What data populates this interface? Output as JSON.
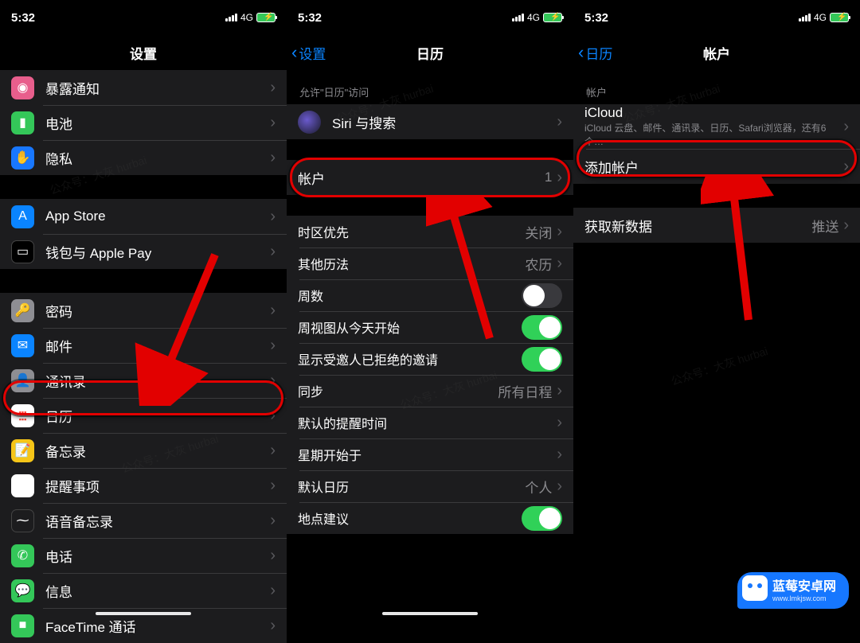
{
  "status": {
    "time": "5:32",
    "network": "4G"
  },
  "panel1": {
    "title": "设置",
    "groups": [
      {
        "items": [
          {
            "id": "exposure",
            "label": "暴露通知",
            "icon": "ic-exposure",
            "glyph": "◉"
          },
          {
            "id": "battery",
            "label": "电池",
            "icon": "ic-battery",
            "glyph": "▮"
          },
          {
            "id": "privacy",
            "label": "隐私",
            "icon": "ic-privacy",
            "glyph": "✋"
          }
        ]
      },
      {
        "items": [
          {
            "id": "appstore",
            "label": "App Store",
            "icon": "ic-appstore",
            "glyph": "A"
          },
          {
            "id": "wallet",
            "label": "钱包与 Apple Pay",
            "icon": "ic-wallet",
            "glyph": "▭"
          }
        ]
      },
      {
        "items": [
          {
            "id": "password",
            "label": "密码",
            "icon": "ic-password",
            "glyph": "🔑"
          },
          {
            "id": "mail",
            "label": "邮件",
            "icon": "ic-mail",
            "glyph": "✉"
          },
          {
            "id": "contacts",
            "label": "通讯录",
            "icon": "ic-contacts",
            "glyph": "👤"
          },
          {
            "id": "calendar",
            "label": "日历",
            "icon": "ic-calendar",
            "glyph": ""
          },
          {
            "id": "notes",
            "label": "备忘录",
            "icon": "ic-notes",
            "glyph": "📝"
          },
          {
            "id": "reminders",
            "label": "提醒事项",
            "icon": "ic-reminders",
            "glyph": "●"
          },
          {
            "id": "voicememo",
            "label": "语音备忘录",
            "icon": "ic-voicememo",
            "glyph": "⁓"
          },
          {
            "id": "phone",
            "label": "电话",
            "icon": "ic-phone",
            "glyph": "✆"
          },
          {
            "id": "messages",
            "label": "信息",
            "icon": "ic-messages",
            "glyph": "💬"
          },
          {
            "id": "facetime",
            "label": "FaceTime 通话",
            "icon": "ic-facetime",
            "glyph": "■"
          }
        ]
      }
    ]
  },
  "panel2": {
    "back": "设置",
    "title": "日历",
    "sectionHeader1": "允许\"日历\"访问",
    "siri": "Siri 与搜索",
    "accounts": {
      "label": "帐户",
      "value": "1"
    },
    "rows": [
      {
        "id": "timezone",
        "label": "时区优先",
        "value": "关闭",
        "type": "val"
      },
      {
        "id": "altcal",
        "label": "其他历法",
        "value": "农历",
        "type": "val"
      },
      {
        "id": "weeknum",
        "label": "周数",
        "on": false,
        "type": "toggle"
      },
      {
        "id": "weekview",
        "label": "周视图从今天开始",
        "on": true,
        "type": "toggle"
      },
      {
        "id": "declined",
        "label": "显示受邀人已拒绝的邀请",
        "on": true,
        "type": "toggle"
      },
      {
        "id": "sync",
        "label": "同步",
        "value": "所有日程",
        "type": "val"
      },
      {
        "id": "defaultalert",
        "label": "默认的提醒时间",
        "value": "",
        "type": "val"
      },
      {
        "id": "weekstart",
        "label": "星期开始于",
        "value": "",
        "type": "val"
      },
      {
        "id": "defaultcal",
        "label": "默认日历",
        "value": "个人",
        "type": "val"
      },
      {
        "id": "locsuggest",
        "label": "地点建议",
        "on": true,
        "type": "toggle"
      }
    ]
  },
  "panel3": {
    "back": "日历",
    "title": "帐户",
    "sectionHeader": "帐户",
    "icloud": {
      "title": "iCloud",
      "sub": "iCloud 云盘、邮件、通讯录、日历、Safari浏览器，还有6个…"
    },
    "addAccount": "添加帐户",
    "fetch": {
      "label": "获取新数据",
      "value": "推送"
    }
  },
  "watermark": "公众号：大灰 hurbai",
  "logo": {
    "title": "蓝莓安卓网",
    "url": "www.lmkjsw.com"
  }
}
